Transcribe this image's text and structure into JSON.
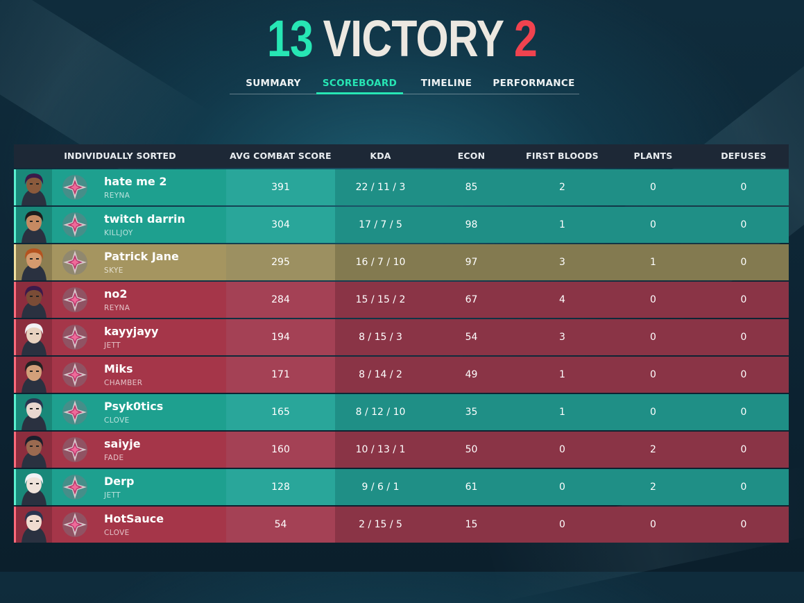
{
  "result": {
    "team_score": "13",
    "text": "VICTORY",
    "enemy_score": "2"
  },
  "tabs": [
    {
      "label": "SUMMARY"
    },
    {
      "label": "SCOREBOARD"
    },
    {
      "label": "TIMELINE"
    },
    {
      "label": "PERFORMANCE"
    }
  ],
  "active_tab": "SCOREBOARD",
  "columns": {
    "player": "INDIVIDUALLY SORTED",
    "acs": "AVG COMBAT SCORE",
    "kda": "KDA",
    "econ": "ECON",
    "first_bloods": "FIRST BLOODS",
    "plants": "PLANTS",
    "defuses": "DEFUSES"
  },
  "players": [
    {
      "name": "hate me 2",
      "agent": "REYNA",
      "acs": "391",
      "kda": "22 / 11 / 3",
      "econ": "85",
      "first_bloods": "2",
      "plants": "0",
      "defuses": "0",
      "team": "win"
    },
    {
      "name": "twitch darrin",
      "agent": "KILLJOY",
      "acs": "304",
      "kda": "17 / 7 / 5",
      "econ": "98",
      "first_bloods": "1",
      "plants": "0",
      "defuses": "0",
      "team": "win"
    },
    {
      "name": "Patrick Jane",
      "agent": "SKYE",
      "acs": "295",
      "kda": "16 / 7 / 10",
      "econ": "97",
      "first_bloods": "3",
      "plants": "1",
      "defuses": "0",
      "team": "me"
    },
    {
      "name": "no2",
      "agent": "REYNA",
      "acs": "284",
      "kda": "15 / 15 / 2",
      "econ": "67",
      "first_bloods": "4",
      "plants": "0",
      "defuses": "0",
      "team": "loss"
    },
    {
      "name": "kayyjayy",
      "agent": "JETT",
      "acs": "194",
      "kda": "8 / 15 / 3",
      "econ": "54",
      "first_bloods": "3",
      "plants": "0",
      "defuses": "0",
      "team": "loss"
    },
    {
      "name": "Miks",
      "agent": "CHAMBER",
      "acs": "171",
      "kda": "8 / 14 / 2",
      "econ": "49",
      "first_bloods": "1",
      "plants": "0",
      "defuses": "0",
      "team": "loss"
    },
    {
      "name": "Psyk0tics",
      "agent": "CLOVE",
      "acs": "165",
      "kda": "8 / 12 / 10",
      "econ": "35",
      "first_bloods": "1",
      "plants": "0",
      "defuses": "0",
      "team": "win"
    },
    {
      "name": "saiyje",
      "agent": "FADE",
      "acs": "160",
      "kda": "10 / 13 / 1",
      "econ": "50",
      "first_bloods": "0",
      "plants": "2",
      "defuses": "0",
      "team": "loss"
    },
    {
      "name": "Derp",
      "agent": "JETT",
      "acs": "128",
      "kda": "9 / 6 / 1",
      "econ": "61",
      "first_bloods": "0",
      "plants": "2",
      "defuses": "0",
      "team": "win"
    },
    {
      "name": "HotSauce",
      "agent": "CLOVE",
      "acs": "54",
      "kda": "2 / 15 / 5",
      "econ": "15",
      "first_bloods": "0",
      "plants": "0",
      "defuses": "0",
      "team": "loss"
    }
  ],
  "colors": {
    "win_accent": "#27e6b4",
    "loss_accent": "#f0434f",
    "win_row": "#1ea08f",
    "loss_row": "#a53649",
    "self_row": "#a59560"
  }
}
